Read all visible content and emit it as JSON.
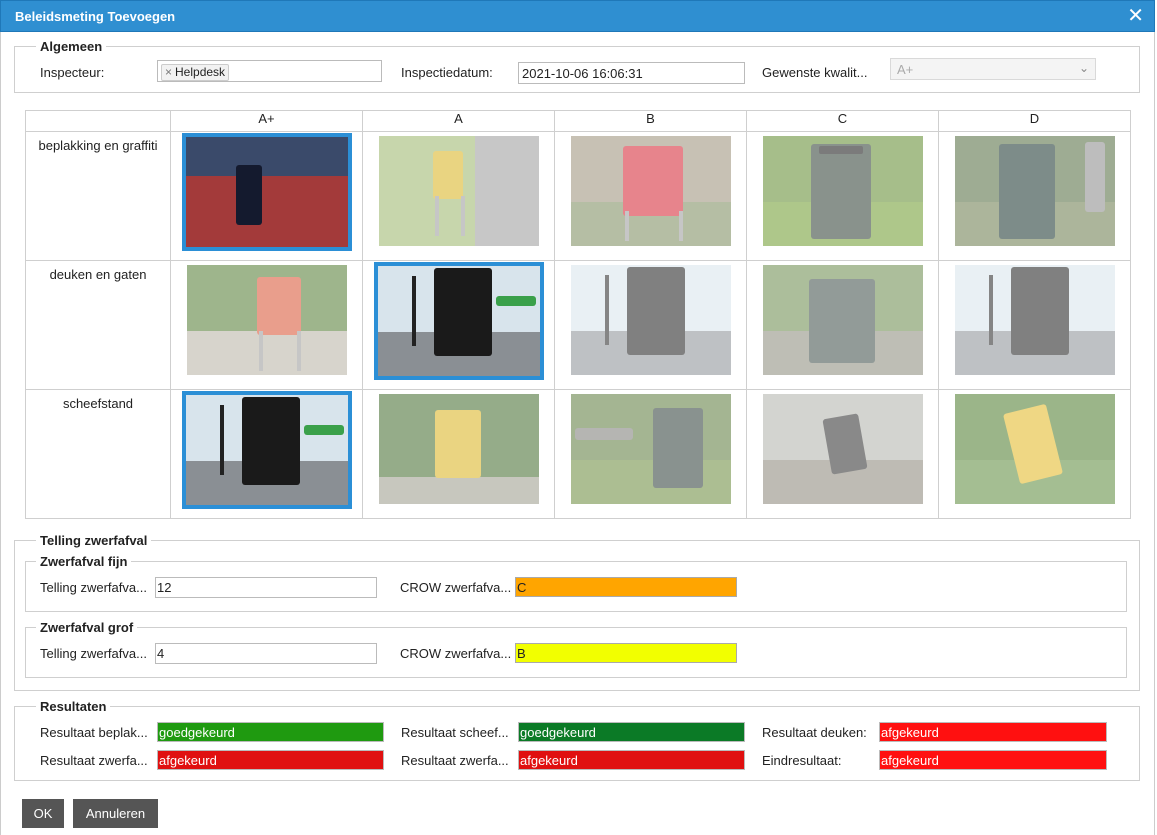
{
  "dialog": {
    "title": "Beleidsmeting Toevoegen",
    "close_glyph": "✕"
  },
  "algemeen": {
    "legend": "Algemeen",
    "inspecteur_label": "Inspecteur:",
    "inspecteur_tag": "Helpdesk",
    "tag_remove": "×",
    "datum_label": "Inspectiedatum:",
    "datum_value": "2021-10-06 16:06:31",
    "kwaliteit_label": "Gewenste kwalit...",
    "kwaliteit_value": "A+"
  },
  "grid": {
    "columns": [
      "A+",
      "A",
      "B",
      "C",
      "D"
    ],
    "rows": [
      {
        "label": "beplakking en graffiti",
        "selected": 0
      },
      {
        "label": "deuken en gaten",
        "selected": 1
      },
      {
        "label": "scheefstand",
        "selected": 0
      }
    ]
  },
  "telling": {
    "legend": "Telling zwerfafval",
    "fijn": {
      "legend": "Zwerfafval fijn",
      "count_label": "Telling zwerfafva...",
      "count_value": "12",
      "crow_label": "CROW zwerfafva...",
      "crow_value": "C",
      "crow_color": "#ffa500"
    },
    "grof": {
      "legend": "Zwerfafval grof",
      "count_label": "Telling zwerfafva...",
      "count_value": "4",
      "crow_label": "CROW zwerfafva...",
      "crow_value": "B",
      "crow_color": "#f2ff00"
    }
  },
  "resultaten": {
    "legend": "Resultaten",
    "items": [
      {
        "label": "Resultaat beplak...",
        "value": "goedgekeurd",
        "color": "#1f9a10"
      },
      {
        "label": "Resultaat scheef...",
        "value": "goedgekeurd",
        "color": "#0b7a26"
      },
      {
        "label": "Resultaat deuken:",
        "value": "afgekeurd",
        "color": "#ff1010"
      },
      {
        "label": "Resultaat zwerfa...",
        "value": "afgekeurd",
        "color": "#e01010"
      },
      {
        "label": "Resultaat zwerfa...",
        "value": "afgekeurd",
        "color": "#e01010"
      },
      {
        "label": "Eindresultaat:",
        "value": "afgekeurd",
        "color": "#ff1010"
      }
    ]
  },
  "buttons": {
    "ok": "OK",
    "cancel": "Annuleren"
  }
}
